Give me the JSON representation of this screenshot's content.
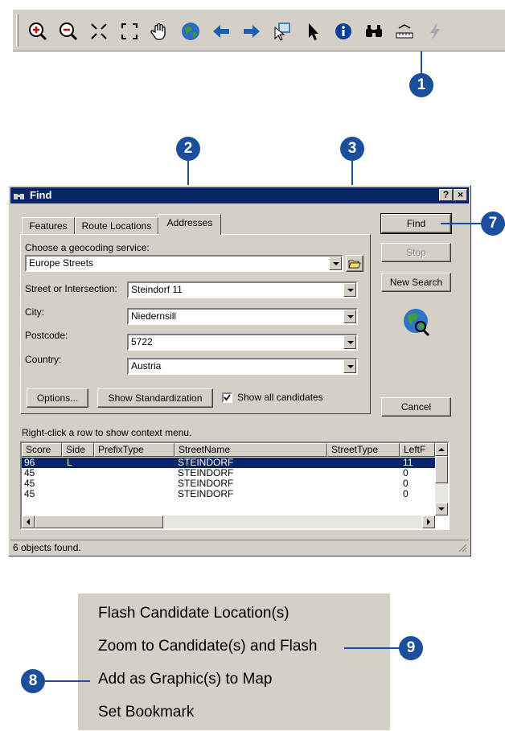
{
  "toolbar": {
    "tools": [
      {
        "icon": "zoom-in-icon"
      },
      {
        "icon": "zoom-out-icon"
      },
      {
        "icon": "fixed-zoom-in-icon"
      },
      {
        "icon": "fixed-zoom-out-icon"
      },
      {
        "icon": "pan-hand-icon"
      },
      {
        "icon": "full-extent-globe-icon"
      },
      {
        "icon": "back-arrow-icon"
      },
      {
        "icon": "forward-arrow-icon"
      },
      {
        "icon": "select-features-icon"
      },
      {
        "icon": "select-elements-arrow-icon"
      },
      {
        "icon": "identify-info-icon"
      },
      {
        "icon": "find-binoculars-icon"
      },
      {
        "icon": "measure-icon"
      },
      {
        "icon": "hyperlink-lightning-icon"
      }
    ]
  },
  "callouts": {
    "c1": "1",
    "c2": "2",
    "c3": "3",
    "c7": "7",
    "c8": "8",
    "c9": "9"
  },
  "dialog": {
    "title": "Find",
    "help_button": "?",
    "close_button": "×",
    "tabs": [
      "Features",
      "Route Locations",
      "Addresses"
    ],
    "active_tab": "Addresses",
    "geocoding_label": "Choose a geocoding service:",
    "geocoding_value": "Europe Streets",
    "street_label": "Street or Intersection:",
    "street_value": "Steindorf 11",
    "city_label": "City:",
    "city_value": "Niedernsill",
    "postcode_label": "Postcode:",
    "postcode_value": "5722",
    "country_label": "Country:",
    "country_value": "Austria",
    "options_button": "Options...",
    "standardization_button": "Show Standardization",
    "show_all_label": "Show all candidates",
    "show_all_checked": true,
    "find_button": "Find",
    "stop_button": "Stop",
    "new_search_button": "New Search",
    "cancel_button": "Cancel",
    "context_hint": "Right-click a row to show context menu.",
    "columns": [
      "Score",
      "Side",
      "PrefixType",
      "StreetName",
      "StreetType",
      "LeftF"
    ],
    "rows": [
      {
        "score": "96",
        "side": "L",
        "prefix": "",
        "street": "STEINDORF",
        "type": "",
        "left": "11",
        "selected": true
      },
      {
        "score": "45",
        "side": "",
        "prefix": "",
        "street": "STEINDORF",
        "type": "",
        "left": "0",
        "selected": false
      },
      {
        "score": "45",
        "side": "",
        "prefix": "",
        "street": "STEINDORF",
        "type": "",
        "left": "0",
        "selected": false
      },
      {
        "score": "45",
        "side": "",
        "prefix": "",
        "street": "STEINDORF",
        "type": "",
        "left": "0",
        "selected": false
      }
    ],
    "status": "6 objects found."
  },
  "context_menu": {
    "items": [
      "Flash Candidate Location(s)",
      "Zoom to Candidate(s) and Flash",
      "Add as Graphic(s) to Map",
      "Set Bookmark"
    ]
  },
  "colors": {
    "callout": "#1b4f9c",
    "titlebar": "#0a246a",
    "selection": "#0a246a",
    "face": "#d4d0c8"
  }
}
